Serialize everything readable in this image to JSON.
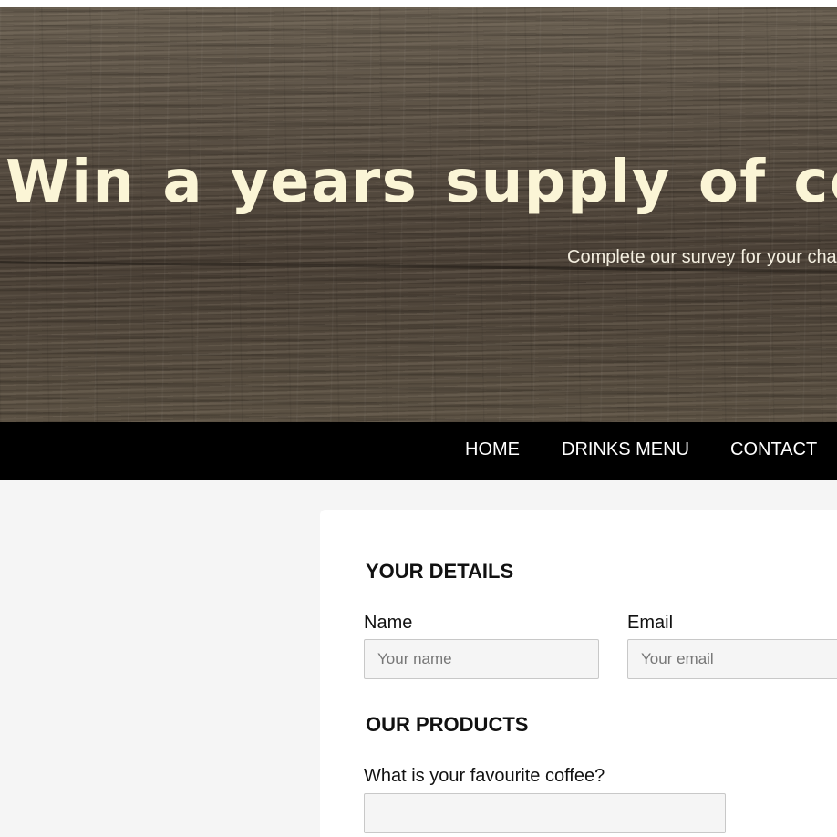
{
  "hero": {
    "title": "Win a years supply of coffee f",
    "subtitle": "Complete our survey for your cha"
  },
  "nav": {
    "items": [
      {
        "label": "HOME"
      },
      {
        "label": "DRINKS MENU"
      },
      {
        "label": "CONTACT"
      }
    ]
  },
  "form": {
    "details_title": "YOUR DETAILS",
    "name_label": "Name",
    "name_placeholder": "Your name",
    "name_value": "",
    "email_label": "Email",
    "email_placeholder": "Your email",
    "email_value": "",
    "products_title": "OUR PRODUCTS",
    "coffee_question": "What is your favourite coffee?",
    "coffee_value": ""
  },
  "colors": {
    "hero_text": "#fbf5d6",
    "nav_bg": "#000000",
    "nav_text": "#ffffff",
    "page_bg": "#f5f5f5",
    "card_bg": "#ffffff"
  }
}
